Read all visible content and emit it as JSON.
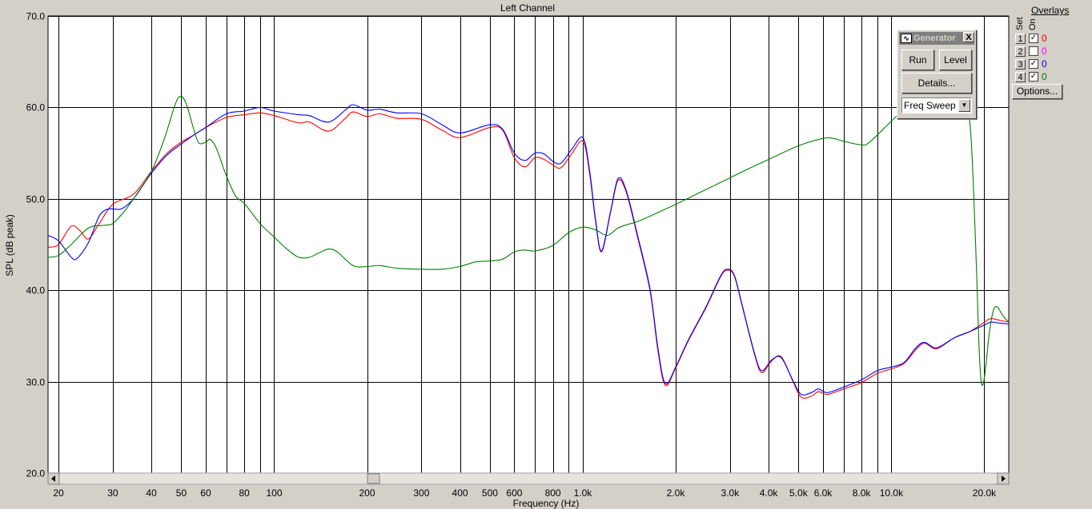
{
  "window_title": "Left Channel",
  "generator": {
    "title": "Generator",
    "close_label": "X",
    "run_label": "Run",
    "level_label": "Level",
    "details_label": "Details...",
    "sweep_value": "Freq Sweep"
  },
  "overlays": {
    "title": "Overlays",
    "set_label": "Set",
    "on_label": "On",
    "rows": [
      {
        "num": "1",
        "checked": true,
        "value": "0",
        "color": "#ff0000"
      },
      {
        "num": "2",
        "checked": false,
        "value": "0",
        "color": "#ff00ff"
      },
      {
        "num": "3",
        "checked": true,
        "value": "0",
        "color": "#0000ff"
      },
      {
        "num": "4",
        "checked": true,
        "value": "0",
        "color": "#008000"
      }
    ],
    "options_label": "Options..."
  },
  "chart_data": {
    "type": "line",
    "title": "Left Channel",
    "xlabel": "Frequency (Hz)",
    "ylabel": "SPL (dB peak)",
    "xscale": "log",
    "xlim": [
      18.5,
      24000
    ],
    "ylim": [
      20,
      70
    ],
    "grid": true,
    "x_ticks": [
      {
        "v": 20,
        "label": "20"
      },
      {
        "v": 30,
        "label": "30"
      },
      {
        "v": 40,
        "label": "40"
      },
      {
        "v": 50,
        "label": "50"
      },
      {
        "v": 60,
        "label": "60"
      },
      {
        "v": 80,
        "label": "80"
      },
      {
        "v": 100,
        "label": "100"
      },
      {
        "v": 200,
        "label": "200"
      },
      {
        "v": 300,
        "label": "300"
      },
      {
        "v": 400,
        "label": "400"
      },
      {
        "v": 500,
        "label": "500"
      },
      {
        "v": 600,
        "label": "600"
      },
      {
        "v": 800,
        "label": "800"
      },
      {
        "v": 1000,
        "label": "1.0k"
      },
      {
        "v": 2000,
        "label": "2.0k"
      },
      {
        "v": 3000,
        "label": "3.0k"
      },
      {
        "v": 4000,
        "label": "4.0k"
      },
      {
        "v": 5000,
        "label": "5.0k"
      },
      {
        "v": 6000,
        "label": "6.0k"
      },
      {
        "v": 8000,
        "label": "8.0k"
      },
      {
        "v": 10000,
        "label": "10.0k"
      },
      {
        "v": 20000,
        "label": "20.0k"
      }
    ],
    "x_minor_grid": [
      70,
      90,
      700,
      900,
      7000,
      9000
    ],
    "y_ticks": [
      {
        "v": 20,
        "label": "20.0"
      },
      {
        "v": 30,
        "label": "30.0"
      },
      {
        "v": 40,
        "label": "40.0"
      },
      {
        "v": 50,
        "label": "50.0"
      },
      {
        "v": 60,
        "label": "60.0"
      },
      {
        "v": 70,
        "label": "70.0"
      }
    ],
    "series": [
      {
        "name": "1",
        "color": "#ff0000",
        "points": [
          [
            18.5,
            44.7
          ],
          [
            20,
            45.0
          ],
          [
            22,
            47.0
          ],
          [
            23.5,
            46.5
          ],
          [
            25,
            45.6
          ],
          [
            27,
            47.2
          ],
          [
            30,
            49.4
          ],
          [
            35,
            50.5
          ],
          [
            40,
            53.0
          ],
          [
            45,
            55.0
          ],
          [
            50,
            56.2
          ],
          [
            55,
            57.0
          ],
          [
            60,
            57.8
          ],
          [
            70,
            58.9
          ],
          [
            80,
            59.2
          ],
          [
            90,
            59.4
          ],
          [
            100,
            59.1
          ],
          [
            120,
            58.3
          ],
          [
            130,
            58.4
          ],
          [
            150,
            57.4
          ],
          [
            170,
            58.8
          ],
          [
            180,
            59.5
          ],
          [
            200,
            59.0
          ],
          [
            220,
            59.3
          ],
          [
            250,
            58.8
          ],
          [
            300,
            58.7
          ],
          [
            350,
            57.5
          ],
          [
            400,
            56.7
          ],
          [
            500,
            57.8
          ],
          [
            550,
            57.5
          ],
          [
            600,
            54.5
          ],
          [
            650,
            53.5
          ],
          [
            700,
            54.5
          ],
          [
            750,
            54.3
          ],
          [
            800,
            53.7
          ],
          [
            850,
            53.4
          ],
          [
            920,
            54.9
          ],
          [
            1000,
            56.3
          ],
          [
            1050,
            53.0
          ],
          [
            1100,
            47.5
          ],
          [
            1150,
            44.2
          ],
          [
            1230,
            48.5
          ],
          [
            1300,
            52.0
          ],
          [
            1380,
            50.8
          ],
          [
            1500,
            46.0
          ],
          [
            1650,
            40.0
          ],
          [
            1750,
            33.5
          ],
          [
            1850,
            29.6
          ],
          [
            2000,
            31.5
          ],
          [
            2200,
            34.5
          ],
          [
            2500,
            38.0
          ],
          [
            2800,
            41.5
          ],
          [
            2950,
            42.2
          ],
          [
            3100,
            41.5
          ],
          [
            3300,
            38.0
          ],
          [
            3600,
            33.0
          ],
          [
            3800,
            31.0
          ],
          [
            4100,
            32.3
          ],
          [
            4400,
            32.7
          ],
          [
            4800,
            30.0
          ],
          [
            5100,
            28.3
          ],
          [
            5500,
            28.4
          ],
          [
            5800,
            28.9
          ],
          [
            6200,
            28.6
          ],
          [
            7000,
            29.2
          ],
          [
            8000,
            29.9
          ],
          [
            9000,
            30.9
          ],
          [
            10000,
            31.4
          ],
          [
            11000,
            32.0
          ],
          [
            12000,
            33.5
          ],
          [
            12800,
            34.2
          ],
          [
            14000,
            33.6
          ],
          [
            16000,
            34.8
          ],
          [
            18000,
            35.5
          ],
          [
            20000,
            36.5
          ],
          [
            21000,
            36.9
          ],
          [
            22500,
            36.7
          ],
          [
            24000,
            36.5
          ]
        ]
      },
      {
        "name": "3",
        "color": "#0000ff",
        "points": [
          [
            18.5,
            46.0
          ],
          [
            20,
            45.4
          ],
          [
            22,
            43.6
          ],
          [
            23,
            43.5
          ],
          [
            25,
            45.2
          ],
          [
            27,
            48.0
          ],
          [
            28.5,
            48.8
          ],
          [
            30,
            48.9
          ],
          [
            32,
            48.9
          ],
          [
            35,
            50.0
          ],
          [
            40,
            52.8
          ],
          [
            45,
            54.8
          ],
          [
            50,
            56.0
          ],
          [
            55,
            57.0
          ],
          [
            60,
            57.8
          ],
          [
            70,
            59.3
          ],
          [
            80,
            59.6
          ],
          [
            90,
            60.0
          ],
          [
            100,
            59.6
          ],
          [
            120,
            59.2
          ],
          [
            130,
            59.1
          ],
          [
            150,
            58.4
          ],
          [
            170,
            59.7
          ],
          [
            180,
            60.3
          ],
          [
            200,
            59.7
          ],
          [
            220,
            59.8
          ],
          [
            250,
            59.4
          ],
          [
            300,
            59.3
          ],
          [
            350,
            58.1
          ],
          [
            400,
            57.2
          ],
          [
            500,
            58.1
          ],
          [
            550,
            57.6
          ],
          [
            600,
            55.0
          ],
          [
            650,
            54.2
          ],
          [
            700,
            55.0
          ],
          [
            750,
            54.9
          ],
          [
            800,
            54.1
          ],
          [
            850,
            53.9
          ],
          [
            920,
            55.4
          ],
          [
            1000,
            56.7
          ],
          [
            1050,
            53.3
          ],
          [
            1100,
            47.7
          ],
          [
            1150,
            44.3
          ],
          [
            1230,
            48.6
          ],
          [
            1300,
            52.2
          ],
          [
            1380,
            51.0
          ],
          [
            1500,
            46.2
          ],
          [
            1650,
            40.2
          ],
          [
            1750,
            33.8
          ],
          [
            1850,
            29.8
          ],
          [
            2000,
            31.6
          ],
          [
            2200,
            34.6
          ],
          [
            2500,
            38.1
          ],
          [
            2800,
            41.6
          ],
          [
            2950,
            42.3
          ],
          [
            3100,
            41.6
          ],
          [
            3300,
            38.1
          ],
          [
            3600,
            33.1
          ],
          [
            3800,
            31.2
          ],
          [
            4100,
            32.4
          ],
          [
            4400,
            32.6
          ],
          [
            4800,
            30.1
          ],
          [
            5100,
            28.6
          ],
          [
            5500,
            28.8
          ],
          [
            5800,
            29.2
          ],
          [
            6200,
            28.8
          ],
          [
            7000,
            29.4
          ],
          [
            8000,
            30.2
          ],
          [
            9000,
            31.2
          ],
          [
            10000,
            31.6
          ],
          [
            11000,
            32.1
          ],
          [
            12000,
            33.7
          ],
          [
            12800,
            34.3
          ],
          [
            14000,
            33.7
          ],
          [
            16000,
            34.8
          ],
          [
            18000,
            35.5
          ],
          [
            20000,
            36.2
          ],
          [
            21000,
            36.5
          ],
          [
            22500,
            36.4
          ],
          [
            24000,
            36.3
          ]
        ]
      },
      {
        "name": "4",
        "color": "#008000",
        "points": [
          [
            18.5,
            43.6
          ],
          [
            20,
            43.8
          ],
          [
            22,
            45.0
          ],
          [
            25,
            46.8
          ],
          [
            28,
            47.1
          ],
          [
            30,
            47.3
          ],
          [
            33,
            48.8
          ],
          [
            36,
            50.6
          ],
          [
            40,
            53.0
          ],
          [
            44,
            56.5
          ],
          [
            48,
            60.5
          ],
          [
            50,
            61.2
          ],
          [
            52,
            60.3
          ],
          [
            55,
            57.5
          ],
          [
            57,
            56.1
          ],
          [
            60,
            56.2
          ],
          [
            62,
            56.5
          ],
          [
            65,
            55.5
          ],
          [
            70,
            52.5
          ],
          [
            75,
            50.3
          ],
          [
            80,
            49.5
          ],
          [
            90,
            47.3
          ],
          [
            100,
            45.8
          ],
          [
            110,
            44.5
          ],
          [
            120,
            43.6
          ],
          [
            130,
            43.6
          ],
          [
            140,
            44.1
          ],
          [
            150,
            44.5
          ],
          [
            160,
            44.2
          ],
          [
            180,
            42.7
          ],
          [
            200,
            42.6
          ],
          [
            220,
            42.7
          ],
          [
            250,
            42.4
          ],
          [
            300,
            42.3
          ],
          [
            350,
            42.3
          ],
          [
            400,
            42.6
          ],
          [
            450,
            43.1
          ],
          [
            500,
            43.2
          ],
          [
            550,
            43.4
          ],
          [
            600,
            44.2
          ],
          [
            650,
            44.4
          ],
          [
            700,
            44.3
          ],
          [
            800,
            44.9
          ],
          [
            900,
            46.3
          ],
          [
            1000,
            46.9
          ],
          [
            1100,
            46.6
          ],
          [
            1200,
            46.0
          ],
          [
            1300,
            46.8
          ],
          [
            1400,
            47.2
          ],
          [
            1500,
            47.5
          ],
          [
            1700,
            48.3
          ],
          [
            2000,
            49.4
          ],
          [
            2500,
            51.0
          ],
          [
            3000,
            52.3
          ],
          [
            3500,
            53.4
          ],
          [
            4000,
            54.3
          ],
          [
            5000,
            55.8
          ],
          [
            6000,
            56.6
          ],
          [
            6500,
            56.6
          ],
          [
            7000,
            56.3
          ],
          [
            8000,
            55.9
          ],
          [
            8500,
            56.2
          ],
          [
            10000,
            58.5
          ],
          [
            11000,
            59.8
          ],
          [
            12000,
            60.6
          ],
          [
            13000,
            61.2
          ],
          [
            14000,
            61.3
          ],
          [
            15000,
            61.0
          ],
          [
            16000,
            60.8
          ],
          [
            17000,
            60.7
          ],
          [
            18000,
            58.0
          ],
          [
            18700,
            46.0
          ],
          [
            19200,
            34.5
          ],
          [
            19500,
            30.3
          ],
          [
            19800,
            29.7
          ],
          [
            20200,
            31.5
          ],
          [
            20800,
            35.5
          ],
          [
            21400,
            37.8
          ],
          [
            22000,
            38.2
          ],
          [
            22700,
            37.5
          ],
          [
            23500,
            36.8
          ],
          [
            24000,
            36.6
          ]
        ]
      }
    ]
  }
}
